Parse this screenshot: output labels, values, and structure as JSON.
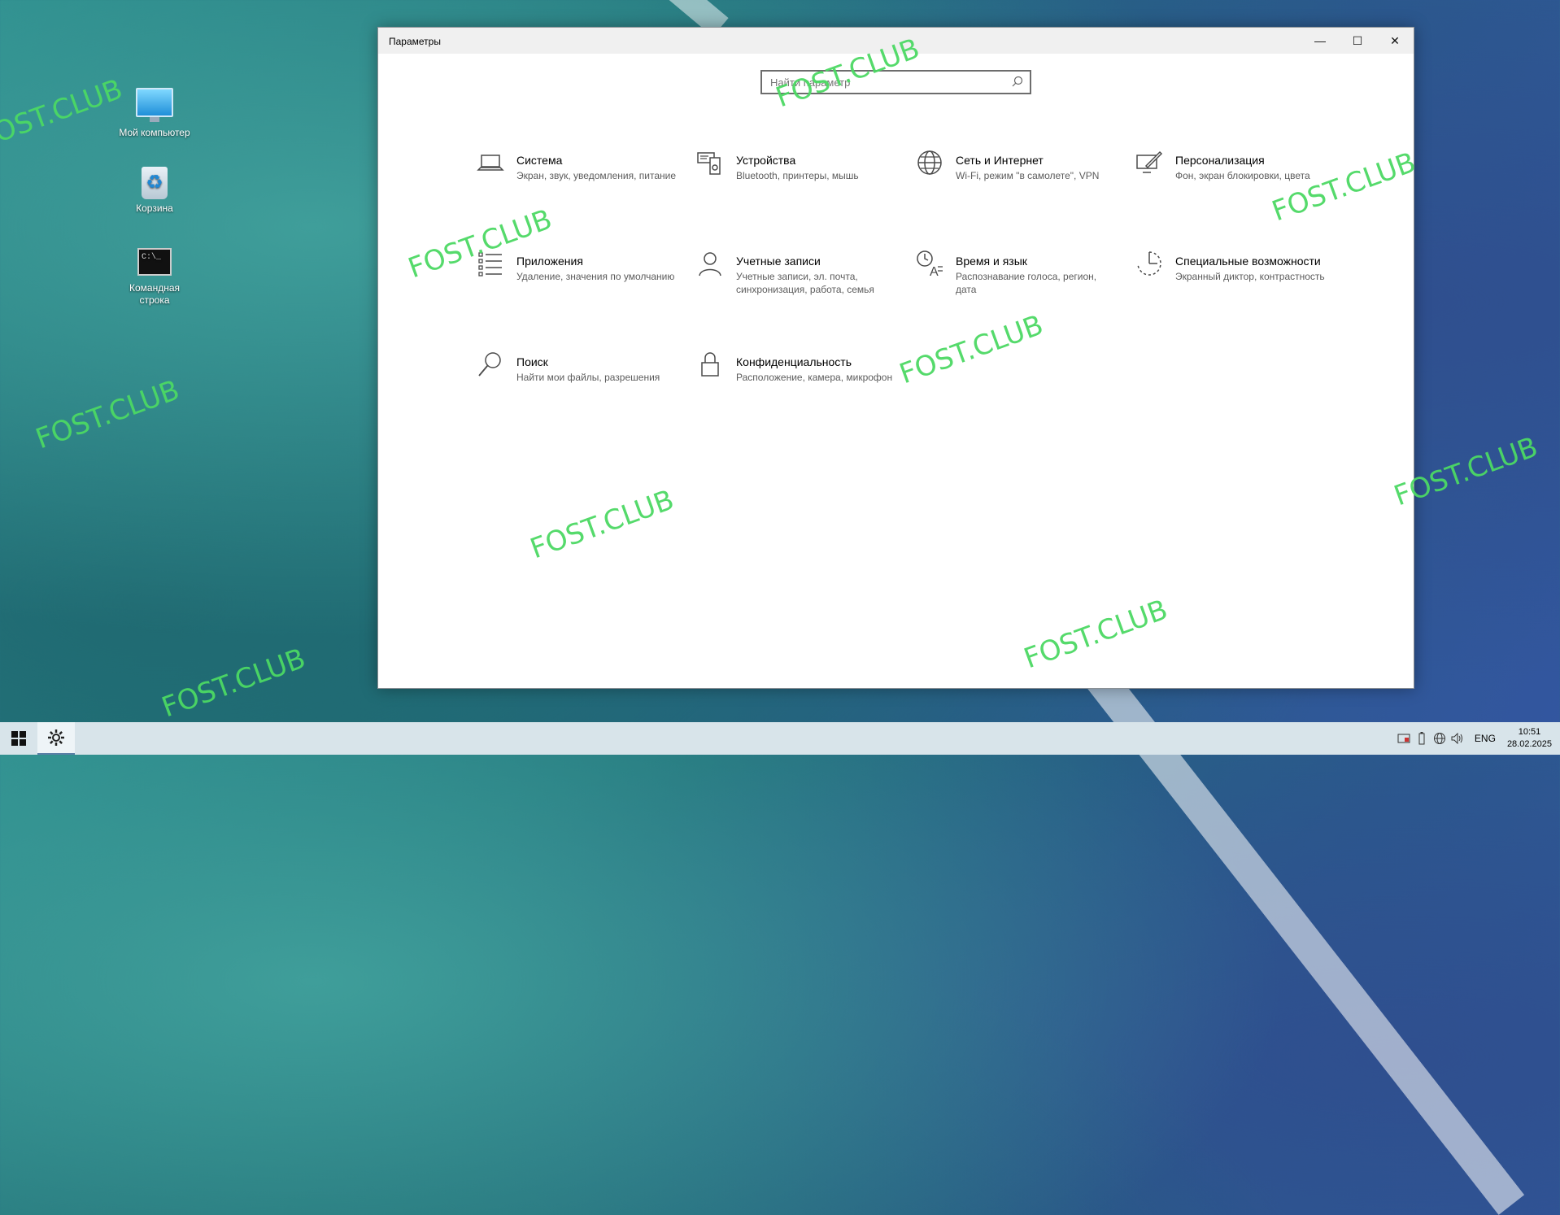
{
  "desktop": {
    "icons": [
      {
        "label": "Мой компьютер",
        "icon": "computer-icon"
      },
      {
        "label": "Корзина",
        "icon": "recycle-bin-icon"
      },
      {
        "label": "Командная строка",
        "icon": "command-prompt-icon"
      }
    ],
    "watermark": "FOST.CLUB"
  },
  "window": {
    "title": "Параметры",
    "controls": {
      "minimize": "—",
      "maximize": "☐",
      "close": "✕"
    },
    "search": {
      "placeholder": "Найти параметр",
      "icon": "search-icon"
    },
    "categories": [
      {
        "name": "Система",
        "desc": "Экран, звук, уведомления, питание",
        "icon": "laptop-icon"
      },
      {
        "name": "Устройства",
        "desc": "Bluetooth, принтеры, мышь",
        "icon": "devices-icon"
      },
      {
        "name": "Сеть и Интернет",
        "desc": "Wi-Fi, режим \"в самолете\", VPN",
        "icon": "globe-icon"
      },
      {
        "name": "Персонализация",
        "desc": "Фон, экран блокировки, цвета",
        "icon": "paint-icon"
      },
      {
        "name": "Приложения",
        "desc": "Удаление, значения по умолчанию",
        "icon": "apps-list-icon"
      },
      {
        "name": "Учетные записи",
        "desc": "Учетные записи, эл. почта, синхронизация, работа, семья",
        "icon": "person-icon"
      },
      {
        "name": "Время и язык",
        "desc": "Распознавание голоса, регион, дата",
        "icon": "time-language-icon"
      },
      {
        "name": "Специальные возможности",
        "desc": "Экранный диктор, контрастность",
        "icon": "accessibility-icon"
      },
      {
        "name": "Поиск",
        "desc": "Найти мои файлы, разрешения",
        "icon": "search-icon"
      },
      {
        "name": "Конфиденциальность",
        "desc": "Расположение, камера, микрофон",
        "icon": "lock-icon"
      }
    ]
  },
  "taskbar": {
    "language": "ENG",
    "time": "10:51",
    "date": "28.02.2025",
    "tray_icons": [
      "security-icon",
      "battery-icon",
      "network-icon",
      "volume-icon"
    ]
  }
}
